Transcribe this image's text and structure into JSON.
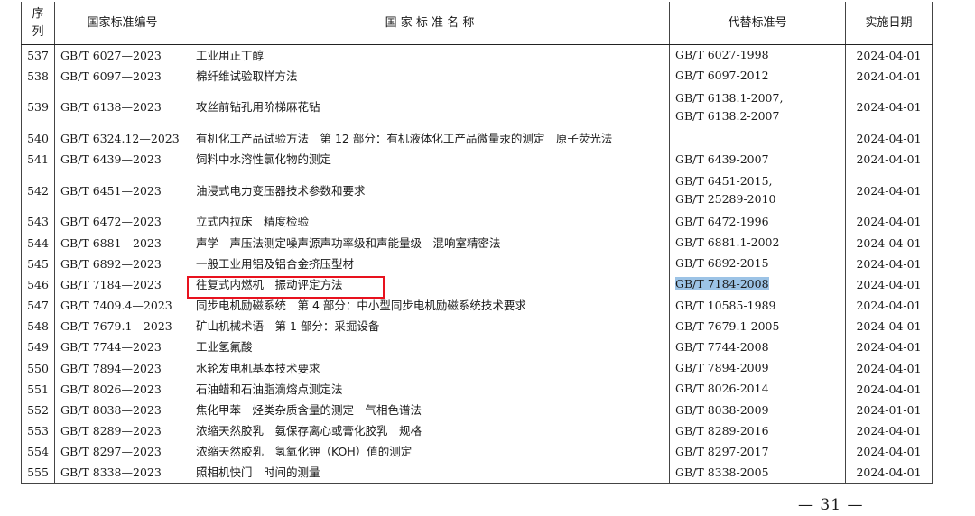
{
  "headers": {
    "seq_line1": "序",
    "seq_line2": "列",
    "code": "国家标准编号",
    "name": "国 家 标 准 名 称",
    "replaced": "代替标准号",
    "date": "实施日期"
  },
  "rows": [
    {
      "seq": "537",
      "code": "GB/T 6027—2023",
      "name": "工业用正丁醇",
      "replaced": [
        "GB/T 6027-1998"
      ],
      "date": "2024-04-01"
    },
    {
      "seq": "538",
      "code": "GB/T 6097—2023",
      "name": "棉纤维试验取样方法",
      "replaced": [
        "GB/T 6097-2012"
      ],
      "date": "2024-04-01"
    },
    {
      "seq": "539",
      "code": "GB/T 6138—2023",
      "name": "攻丝前钻孔用阶梯麻花钻",
      "replaced": [
        "GB/T 6138.1-2007,",
        "GB/T 6138.2-2007"
      ],
      "date": "2024-04-01"
    },
    {
      "seq": "540",
      "code": "GB/T 6324.12—2023",
      "name": "有机化工产品试验方法　第 12 部分：有机液体化工产品微量汞的测定　原子荧光法",
      "replaced": [],
      "date": "2024-04-01"
    },
    {
      "seq": "541",
      "code": "GB/T 6439—2023",
      "name": "饲料中水溶性氯化物的测定",
      "replaced": [
        "GB/T 6439-2007"
      ],
      "date": "2024-04-01"
    },
    {
      "seq": "542",
      "code": "GB/T 6451—2023",
      "name": "油浸式电力变压器技术参数和要求",
      "replaced": [
        "GB/T 6451-2015,",
        "GB/T 25289-2010"
      ],
      "date": "2024-04-01"
    },
    {
      "seq": "543",
      "code": "GB/T 6472—2023",
      "name": "立式内拉床　精度检验",
      "replaced": [
        "GB/T 6472-1996"
      ],
      "date": "2024-04-01"
    },
    {
      "seq": "544",
      "code": "GB/T 6881—2023",
      "name": "声学　声压法测定噪声源声功率级和声能量级　混响室精密法",
      "replaced": [
        "GB/T 6881.1-2002"
      ],
      "date": "2024-04-01"
    },
    {
      "seq": "545",
      "code": "GB/T 6892—2023",
      "name": "一般工业用铝及铝合金挤压型材",
      "replaced": [
        "GB/T 6892-2015"
      ],
      "date": "2024-04-01"
    },
    {
      "seq": "546",
      "code": "GB/T 7184—2023",
      "name": "往复式内燃机　振动评定方法",
      "replaced": [
        "GB/T 7184-2008"
      ],
      "date": "2024-04-01"
    },
    {
      "seq": "547",
      "code": "GB/T 7409.4—2023",
      "name": "同步电机励磁系统　第 4 部分：中小型同步电机励磁系统技术要求",
      "replaced": [
        "GB/T 10585-1989"
      ],
      "date": "2024-04-01"
    },
    {
      "seq": "548",
      "code": "GB/T 7679.1—2023",
      "name": "矿山机械术语　第 1 部分：采掘设备",
      "replaced": [
        "GB/T 7679.1-2005"
      ],
      "date": "2024-04-01"
    },
    {
      "seq": "549",
      "code": "GB/T 7744—2023",
      "name": "工业氢氟酸",
      "replaced": [
        "GB/T 7744-2008"
      ],
      "date": "2024-04-01"
    },
    {
      "seq": "550",
      "code": "GB/T 7894—2023",
      "name": "水轮发电机基本技术要求",
      "replaced": [
        "GB/T 7894-2009"
      ],
      "date": "2024-04-01"
    },
    {
      "seq": "551",
      "code": "GB/T 8026—2023",
      "name": "石油蜡和石油脂滴熔点测定法",
      "replaced": [
        "GB/T 8026-2014"
      ],
      "date": "2024-04-01"
    },
    {
      "seq": "552",
      "code": "GB/T 8038—2023",
      "name": "焦化甲苯　烃类杂质含量的测定　气相色谱法",
      "replaced": [
        "GB/T 8038-2009"
      ],
      "date": "2024-01-01"
    },
    {
      "seq": "553",
      "code": "GB/T 8289—2023",
      "name": "浓缩天然胶乳　氨保存离心或膏化胶乳　规格",
      "replaced": [
        "GB/T 8289-2016"
      ],
      "date": "2024-04-01"
    },
    {
      "seq": "554",
      "code": "GB/T 8297—2023",
      "name": "浓缩天然胶乳　氢氧化钾（KOH）值的测定",
      "replaced": [
        "GB/T 8297-2017"
      ],
      "date": "2024-04-01"
    },
    {
      "seq": "555",
      "code": "GB/T 8338—2023",
      "name": "照相机快门　时间的测量",
      "replaced": [
        "GB/T 8338-2005"
      ],
      "date": "2024-04-01"
    }
  ],
  "highlight": {
    "row_seq": "546",
    "color": "#e8121e",
    "selection_color": "#9cc3e6"
  },
  "page_number": "— 31 —"
}
